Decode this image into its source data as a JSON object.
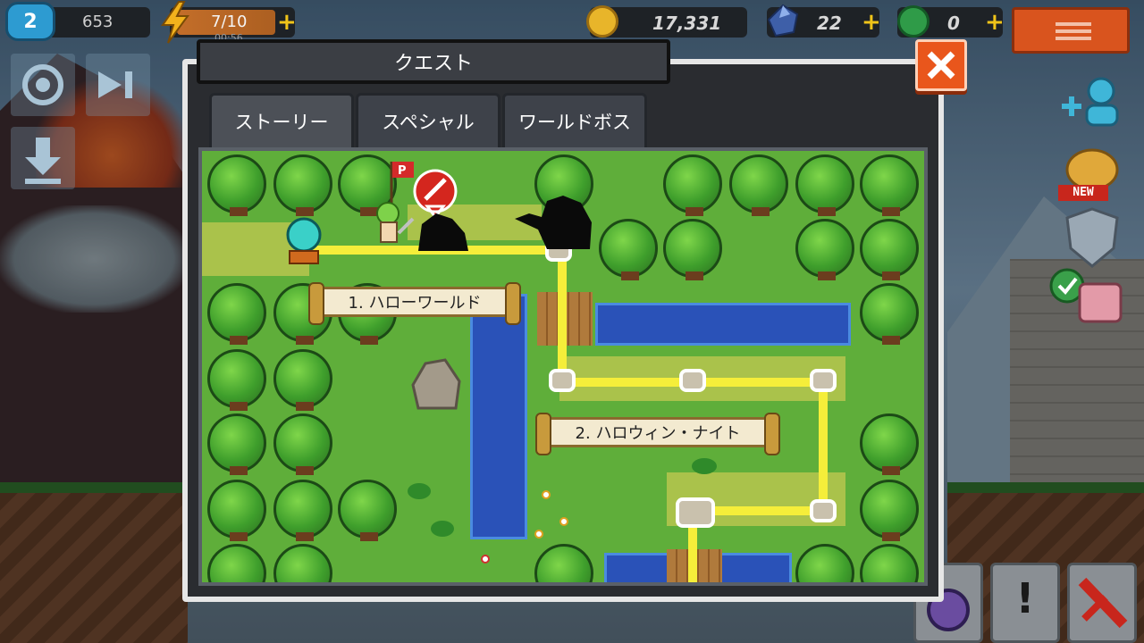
{
  "hud": {
    "level": "2",
    "exp": "653",
    "stamina": "7/10",
    "stamina_timer": "00:56",
    "gold": "17,331",
    "gems": "22",
    "tickets": "0",
    "plus_symbol": "+"
  },
  "modal": {
    "title": "クエスト",
    "tabs": [
      {
        "label": "ストーリー",
        "active": true
      },
      {
        "label": "スペシャル",
        "active": false
      },
      {
        "label": "ワールドボス",
        "active": false
      }
    ],
    "quests": [
      {
        "label": "1. ハローワールド"
      },
      {
        "label": "2. ハロウィン・ナイト"
      }
    ]
  },
  "map_flag_letter": "P",
  "badges": {
    "new": "NEW"
  },
  "icons": {
    "menu": "hamburger-icon",
    "close": "close-icon",
    "gold": "coin-icon",
    "gem": "gem-icon",
    "ticket": "ticket-icon",
    "stamina": "lightning-icon",
    "exclamation": "!"
  },
  "colors": {
    "accent_orange": "#e9561c",
    "map_grass": "#5fae3a",
    "path_yellow": "#f5ee3a",
    "river_blue": "#2a52b8"
  }
}
